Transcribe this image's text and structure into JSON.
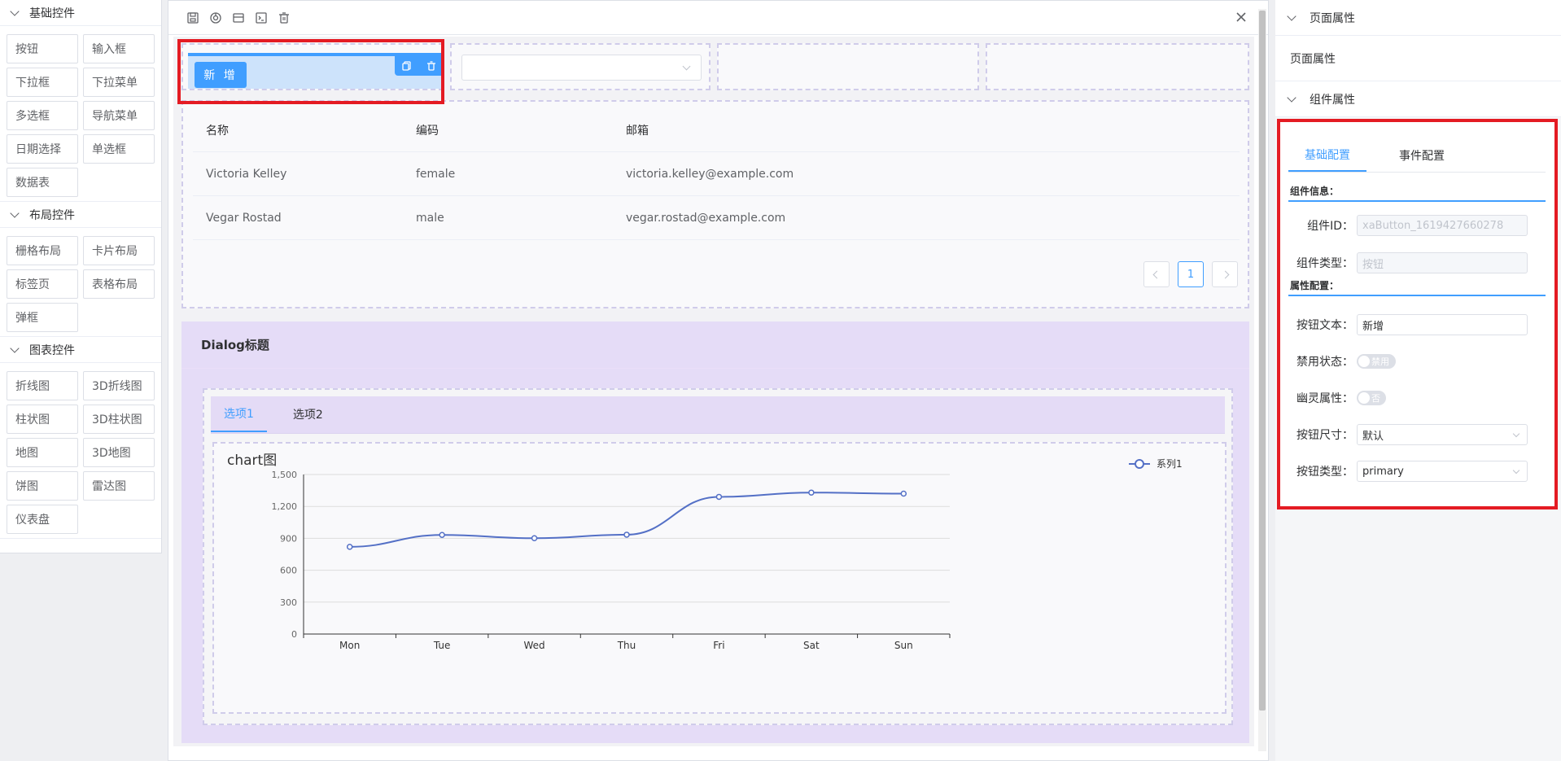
{
  "left_panel": {
    "sections": [
      {
        "title": "基础控件",
        "items": [
          "按钮",
          "输入框",
          "下拉框",
          "下拉菜单",
          "多选框",
          "导航菜单",
          "日期选择",
          "单选框",
          "数据表"
        ]
      },
      {
        "title": "布局控件",
        "items": [
          "栅格布局",
          "卡片布局",
          "标签页",
          "表格布局",
          "弹框"
        ]
      },
      {
        "title": "图表控件",
        "items": [
          "折线图",
          "3D折线图",
          "柱状图",
          "3D柱状图",
          "地图",
          "3D地图",
          "饼图",
          "雷达图",
          "仪表盘"
        ]
      }
    ]
  },
  "toolbar": {
    "icons": [
      "save-icon",
      "preview-icon",
      "layout-icon",
      "code-icon",
      "delete-icon",
      "close-icon"
    ]
  },
  "canvas": {
    "button_label": "新 增",
    "table": {
      "headers": [
        "名称",
        "编码",
        "邮箱"
      ],
      "rows": [
        [
          "Victoria Kelley",
          "female",
          "victoria.kelley@example.com"
        ],
        [
          "Vegar Rostad",
          "male",
          "vegar.rostad@example.com"
        ]
      ],
      "current_page": "1"
    },
    "dialog": {
      "title": "Dialog标题",
      "tabs": [
        "选项1",
        "选项2"
      ]
    }
  },
  "chart_data": {
    "type": "line",
    "title": "chart图",
    "categories": [
      "Mon",
      "Tue",
      "Wed",
      "Thu",
      "Fri",
      "Sat",
      "Sun"
    ],
    "series": [
      {
        "name": "系列1",
        "values": [
          820,
          932,
          901,
          934,
          1290,
          1330,
          1320
        ],
        "color": "#5470c6"
      }
    ],
    "yticks": [
      "0",
      "300",
      "600",
      "900",
      "1,200",
      "1,500"
    ],
    "ylim": [
      0,
      1500
    ],
    "smooth": true,
    "grid": true,
    "legend": "top-right"
  },
  "right_panel": {
    "page_section_title": "页面属性",
    "page_section_body": "页面属性",
    "component_section_title": "组件属性",
    "tabs": [
      "基础配置",
      "事件配置"
    ],
    "group_info": "组件信息：",
    "group_props": "属性配置：",
    "fields": {
      "id_label": "组件ID：",
      "id_value": "xaButton_1619427660278",
      "type_label": "组件类型：",
      "type_value": "按钮",
      "text_label": "按钮文本：",
      "text_value": "新增",
      "disabled_label": "禁用状态：",
      "disabled_value": "禁用",
      "ghost_label": "幽灵属性：",
      "ghost_value": "否",
      "size_label": "按钮尺寸：",
      "size_value": "默认",
      "btntype_label": "按钮类型：",
      "btntype_value": "primary"
    }
  },
  "colors": {
    "accent": "#409eff",
    "highlight": "#e41b23",
    "dialog_bg": "#e5dcf7",
    "series": "#5470c6"
  }
}
